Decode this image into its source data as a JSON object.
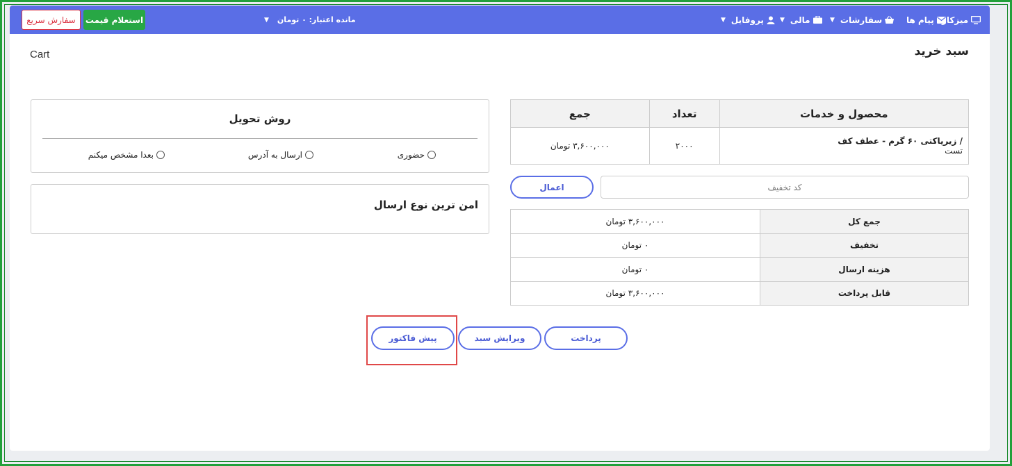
{
  "navbar": {
    "dashboard": "میزکار",
    "messages": "پیام ها",
    "orders": "سفارشات",
    "finance": "مالی",
    "profile": "پروفایل",
    "credit_label": "مانده اعتبار: ۰ تومان",
    "quote_button": "استعلام قیمت",
    "quick_order_button": "سفارش سریع"
  },
  "page": {
    "title": "سبد خرید",
    "breadcrumb": "Cart"
  },
  "cart": {
    "headers": [
      "محصول و خدمات",
      "تعداد",
      "جمع"
    ],
    "items": [
      {
        "product": "/ زیرپاکتی ۶۰ گرم - عطف کف",
        "product_sub": "تست",
        "quantity": "۲۰۰۰",
        "total": "۳,۶۰۰,۰۰۰ تومان"
      }
    ]
  },
  "discount": {
    "placeholder": "کد تخفیف",
    "apply_label": "اعمال"
  },
  "summary": [
    {
      "label": "جمع کل",
      "value": "۳,۶۰۰,۰۰۰ تومان"
    },
    {
      "label": "تخفیف",
      "value": "۰ تومان"
    },
    {
      "label": "هزینه ارسال",
      "value": "۰ تومان"
    },
    {
      "label": "قابل پرداخت",
      "value": "۳,۶۰۰,۰۰۰ تومان"
    }
  ],
  "delivery": {
    "title": "روش تحویل",
    "options": [
      "حضوری",
      "ارسال به آدرس",
      "بعدا مشخص میکنم"
    ]
  },
  "shipping_note": "امن ترین نوع ارسال",
  "actions": {
    "pay": "پرداخت",
    "edit_cart": "ویرایش سبد",
    "proforma": "پیش فاکتور"
  },
  "colors": {
    "navbar": "#5a6ee6",
    "quote_button": "#28a745",
    "quick_order_border": "#dc3545",
    "frame_border": "#22a03a",
    "highlight": "#e04848"
  }
}
